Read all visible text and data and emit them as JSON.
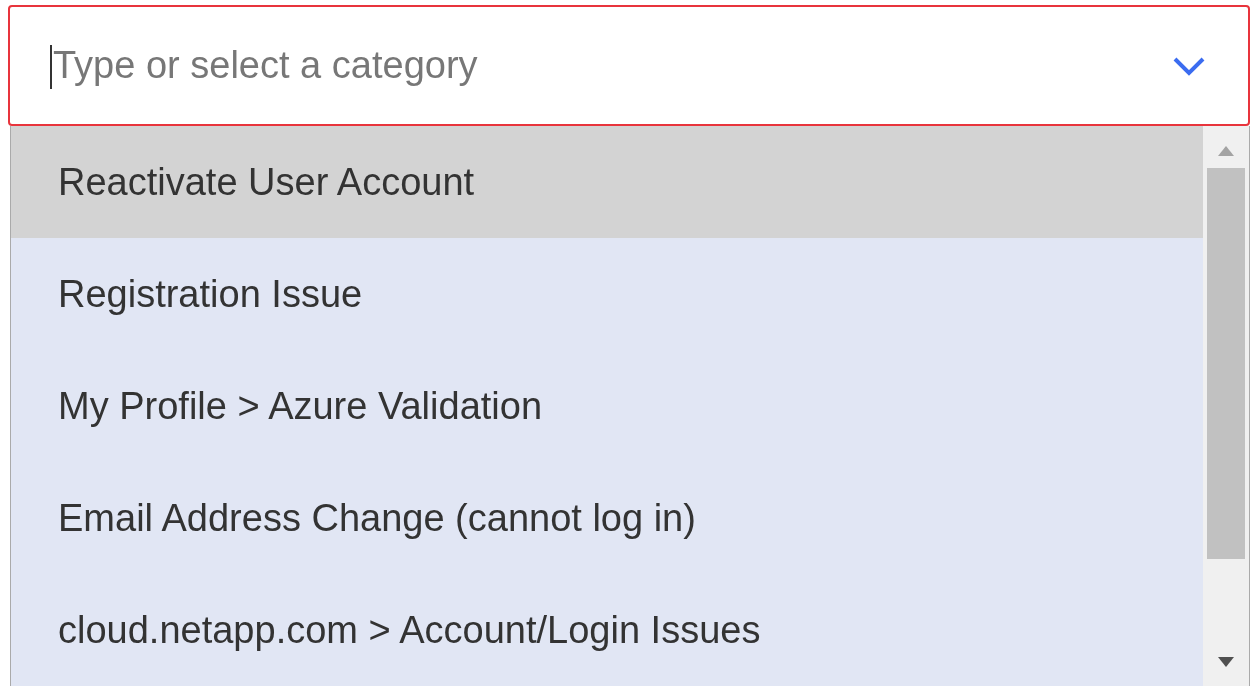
{
  "category_field": {
    "placeholder": "Type or select a category"
  },
  "options": [
    {
      "label": "Reactivate User Account",
      "selected": true
    },
    {
      "label": "Registration Issue",
      "selected": false
    },
    {
      "label": "My Profile > Azure Validation",
      "selected": false
    },
    {
      "label": "Email Address Change (cannot log in)",
      "selected": false
    },
    {
      "label": "cloud.netapp.com > Account/Login Issues",
      "selected": false
    }
  ]
}
